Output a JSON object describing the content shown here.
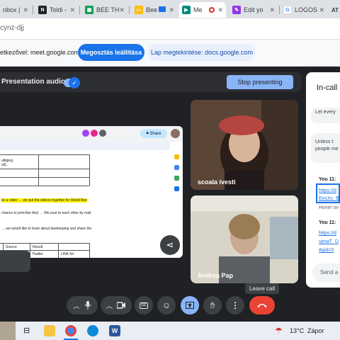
{
  "browser": {
    "tabs": [
      {
        "title": "nbox |",
        "icon": "gmail-icon",
        "color": "#ea4335"
      },
      {
        "title": "Toldi -",
        "icon": "notion-icon",
        "color": "#202124"
      },
      {
        "title": "BEE TH",
        "icon": "sheets-icon",
        "color": "#0f9d58"
      },
      {
        "title": "Bee",
        "icon": "slides-icon",
        "color": "#1a73e8"
      },
      {
        "title": "Me",
        "icon": "meet-icon",
        "color": "#00897b"
      },
      {
        "title": "Edit yo",
        "icon": "puzzle-icon",
        "color": "#9334e6"
      },
      {
        "title": "LOGOS",
        "icon": "google-icon",
        "color": "#fbbc04"
      },
      {
        "title": "AT",
        "icon": "at-icon",
        "color": "#202124"
      }
    ],
    "url": "cynz-djj"
  },
  "share_banner": {
    "message": "etkezővel: meet.google.com",
    "stop_sharing": "Megosztás leállítása",
    "show_tab": "Lap megtekintése: docs.google.com"
  },
  "presentation": {
    "audio_label": "Presentation audio",
    "stop_presenting": "Stop presenting"
  },
  "doc": {
    "share_label": "Share",
    "lines": [
      "ultigieg,",
      "uli),",
      "ke a video → we put the videos together for World Bee",
      "chance to print like this) → We post to each other by mail",
      "→ we would like to learn about beekeeping and share the",
      "Source",
      "Result",
      "Padlet",
      "LINK for"
    ],
    "highlighted_line": "ke a video → we put the videos together for World Bee"
  },
  "participants": [
    {
      "name": "scoala ivesti"
    },
    {
      "name": "Andrea Pap"
    }
  ],
  "chat": {
    "title": "In-call",
    "messages": [
      {
        "type": "bubble",
        "text": "Let every"
      },
      {
        "type": "bubble",
        "text": "Unless t people me"
      },
      {
        "type": "sender",
        "text": "You  11:"
      },
      {
        "type": "link",
        "text": "https://d EnxXc_B"
      },
      {
        "type": "hover",
        "text": "Hover ov"
      },
      {
        "type": "sender",
        "text": "You  11:"
      },
      {
        "type": "link",
        "text": "https://d vjmaT_D #gid=0"
      }
    ],
    "send_placeholder": "Send a m"
  },
  "controls": {
    "leave_tooltip": "Leave call",
    "cc_label": "CC"
  },
  "taskbar": {
    "temperature": "13°C",
    "weather": "Zápor"
  }
}
